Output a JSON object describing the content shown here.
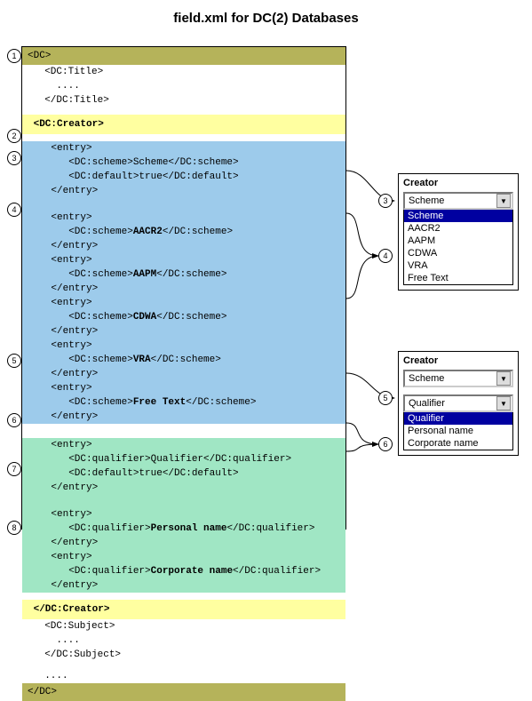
{
  "title": "field.xml for DC(2) Databases",
  "markers": [
    "1",
    "2",
    "3",
    "4",
    "5",
    "6",
    "7",
    "8"
  ],
  "xml": {
    "open": "<DC>",
    "title_open": "  <DC:Title>",
    "dots4": "    ....",
    "title_close": "  </DC:Title>",
    "creator_open": " <DC:Creator>",
    "entry_open": "    <entry>",
    "entry_close": "    </entry>",
    "scheme_default": "       <DC:scheme>Scheme</DC:scheme>",
    "default_true": "       <DC:default>true</DC:default>",
    "scheme_a_pre": "       <DC:scheme>",
    "scheme_a_val": "AACR2",
    "scheme_a_suf": "</DC:scheme>",
    "scheme_b_pre": "       <DC:scheme>",
    "scheme_b_val": "AAPM",
    "scheme_b_suf": "</DC:scheme>",
    "scheme_c_pre": "       <DC:scheme>",
    "scheme_c_val": "CDWA",
    "scheme_c_suf": "</DC:scheme>",
    "scheme_d_pre": "       <DC:scheme>",
    "scheme_d_val": "VRA",
    "scheme_d_suf": "</DC:scheme>",
    "scheme_e_pre": "       <DC:scheme>",
    "scheme_e_val": "Free Text",
    "scheme_e_suf": "</DC:scheme>",
    "qual_default": "       <DC:qualifier>Qualifier</DC:qualifier>",
    "qual_a_pre": "       <DC:qualifier>",
    "qual_a_val": "Personal name",
    "qual_a_suf": "</DC:qualifier>",
    "qual_b_pre": "       <DC:qualifier>",
    "qual_b_val": "Corporate name",
    "qual_b_suf": "</DC:qualifier>",
    "creator_close": " </DC:Creator>",
    "subject_open": "  <DC:Subject>",
    "subject_close": "  </DC:Subject>",
    "dots2": "  ....",
    "close": "</DC>"
  },
  "panel1": {
    "title": "Creator",
    "combo": "Scheme",
    "options": [
      "Scheme",
      "AACR2",
      "AAPM",
      "CDWA",
      "VRA",
      "Free Text"
    ]
  },
  "panel2": {
    "title": "Creator",
    "scheme_combo": "Scheme",
    "qual_combo": "Qualifier",
    "options": [
      "Qualifier",
      "Personal name",
      "Corporate name"
    ]
  }
}
